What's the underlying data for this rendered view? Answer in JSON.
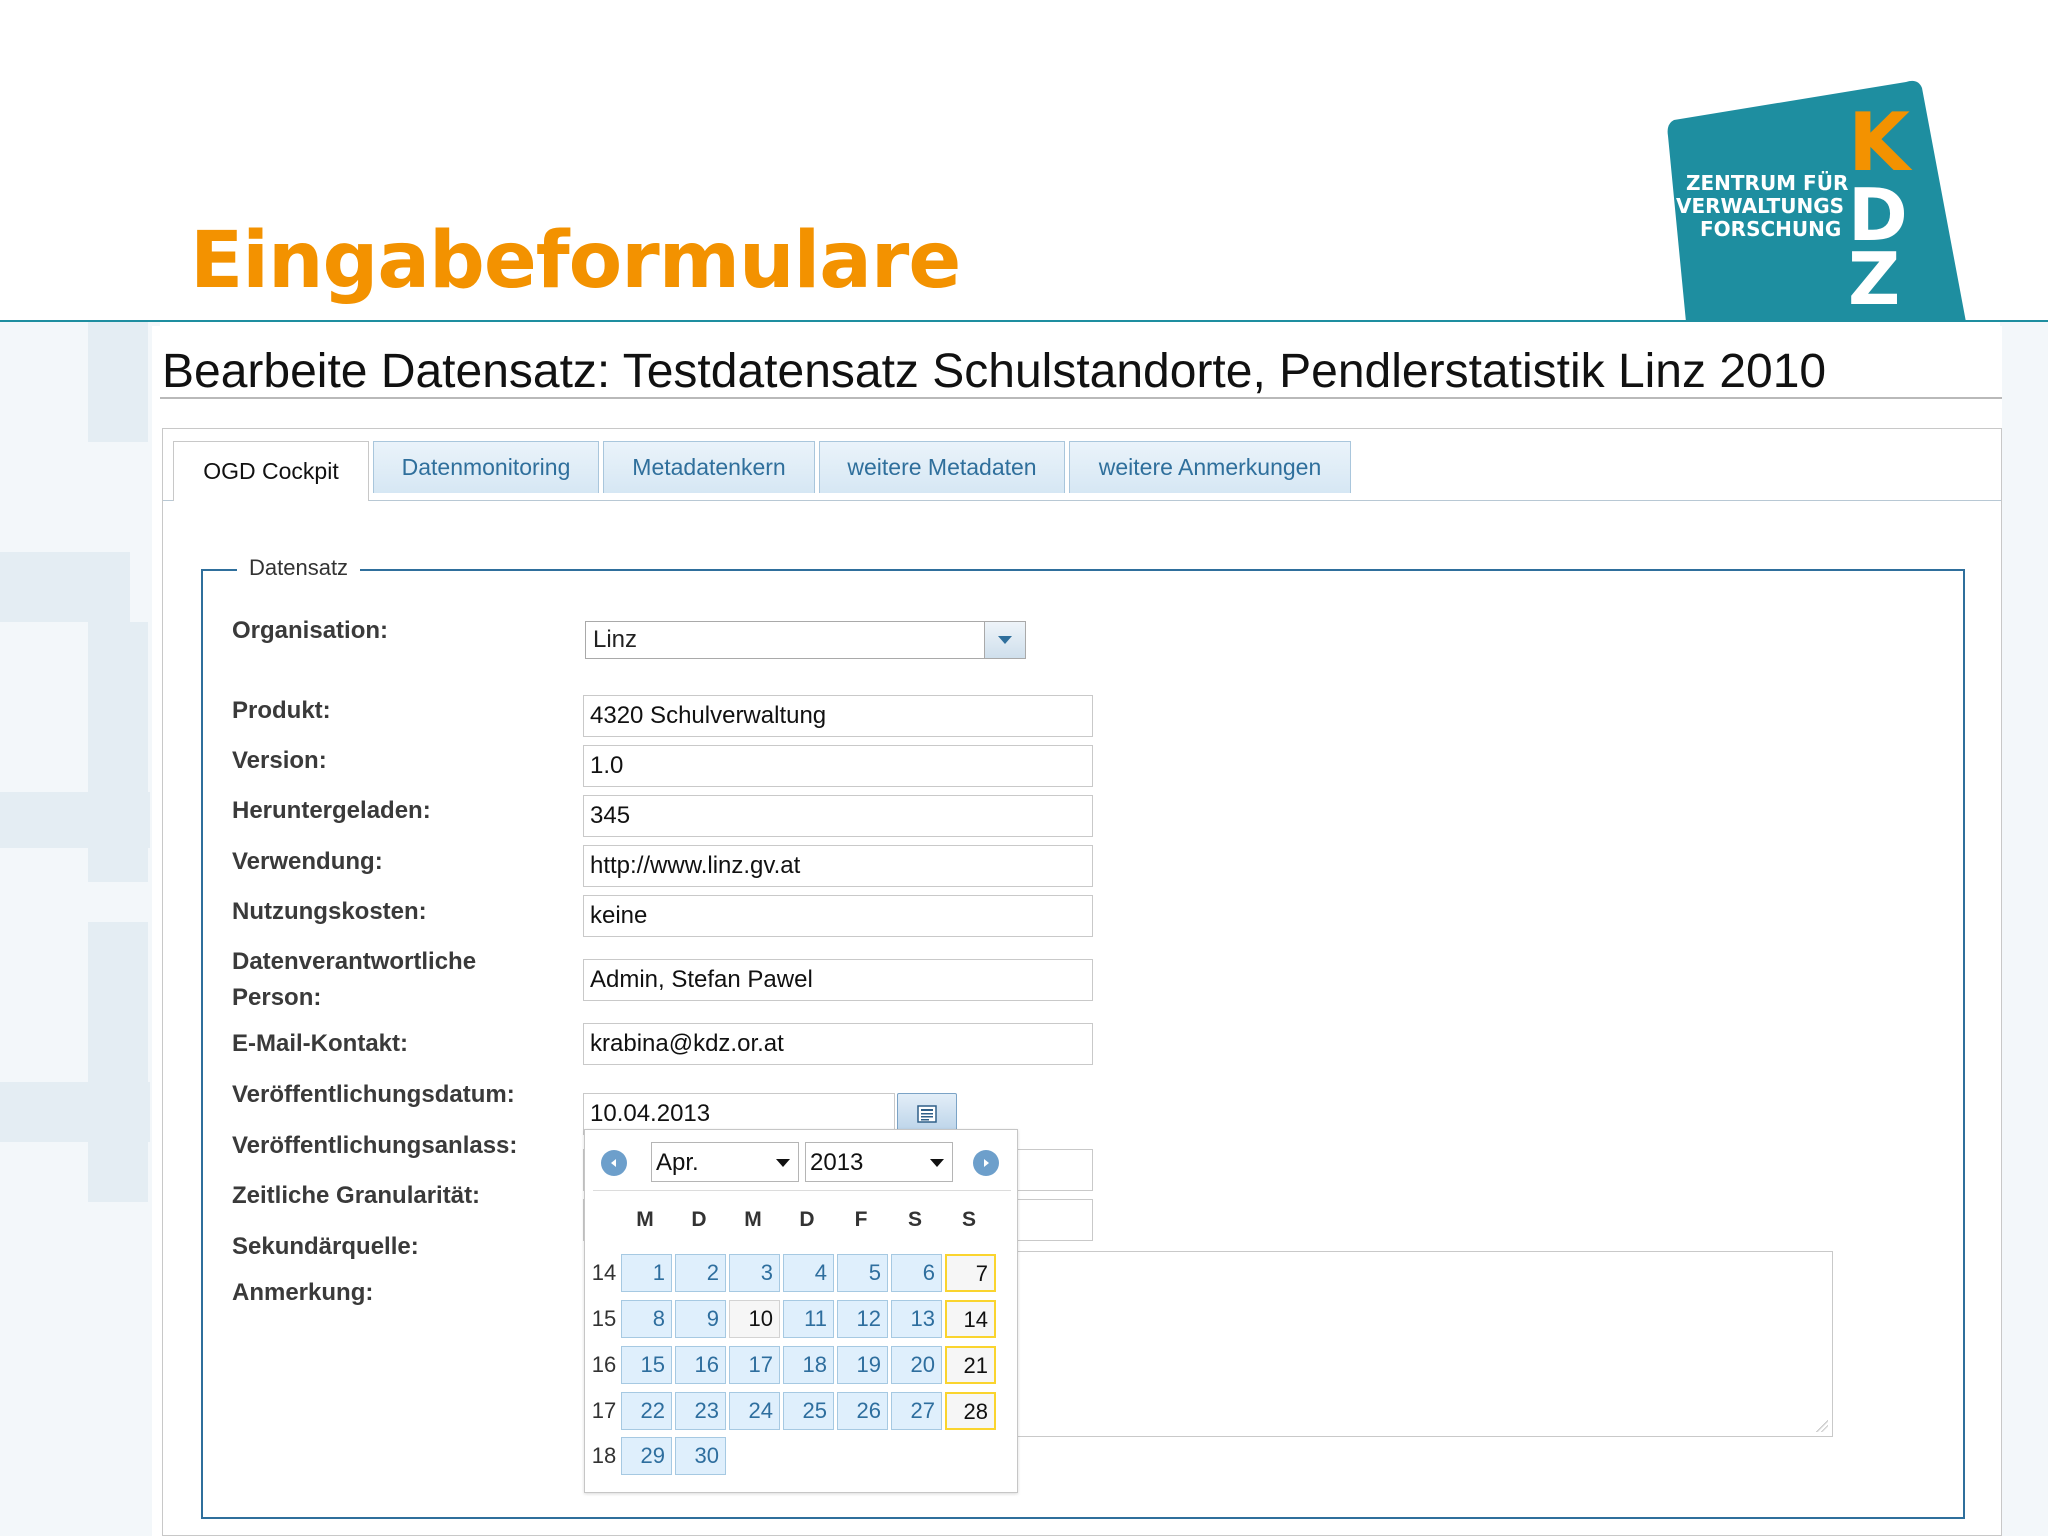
{
  "slide": {
    "title": "Eingabeformulare",
    "logo": {
      "text_lines": [
        "ZENTRUM FÜR",
        "VERWALTUNGS",
        "FORSCHUNG"
      ],
      "letters": [
        "K",
        "D",
        "Z"
      ],
      "brand_color": "#1e8ea0",
      "accent_color": "#f39200"
    }
  },
  "page": {
    "heading": "Bearbeite Datensatz: Testdatensatz Schulstandorte, Pendlerstatistik Linz 2010"
  },
  "tabs": [
    {
      "label": "OGD Cockpit",
      "active": true
    },
    {
      "label": "Datenmonitoring",
      "active": false
    },
    {
      "label": "Metadatenkern",
      "active": false
    },
    {
      "label": "weitere Metadaten",
      "active": false
    },
    {
      "label": "weitere Anmerkungen",
      "active": false
    }
  ],
  "form": {
    "legend": "Datensatz",
    "organisation": {
      "label": "Organisation:",
      "value": "Linz"
    },
    "produkt": {
      "label": "Produkt:",
      "value": "4320 Schulverwaltung"
    },
    "version": {
      "label": "Version:",
      "value": "1.0"
    },
    "heruntergeladen": {
      "label": "Heruntergeladen:",
      "value": "345"
    },
    "verwendung": {
      "label": "Verwendung:",
      "value": "http://www.linz.gv.at"
    },
    "nutzungskosten": {
      "label": "Nutzungskosten:",
      "value": "keine"
    },
    "datenverantwortliche": {
      "label_line1": "Datenverantwortliche",
      "label_line2": "Person:",
      "value": "Admin, Stefan Pawel"
    },
    "email": {
      "label": "E-Mail-Kontakt:",
      "value": "krabina@kdz.or.at"
    },
    "veroeffentlichungsdatum": {
      "label": "Veröffentlichungsdatum:",
      "value": "10.04.2013"
    },
    "veroeffentlichungsanlass": {
      "label": "Veröffentlichungsanlass:",
      "value": ""
    },
    "zeitliche_granularitaet": {
      "label": "Zeitliche Granularität:",
      "value": ""
    },
    "sekundaerquelle": {
      "label": "Sekundärquelle:"
    },
    "anmerkung": {
      "label": "Anmerkung:",
      "value": ""
    }
  },
  "calendar": {
    "month": "Apr.",
    "year": "2013",
    "weekdays": [
      "M",
      "D",
      "M",
      "D",
      "F",
      "S",
      "S"
    ],
    "weeks": [
      {
        "week": "14",
        "days": [
          "1",
          "2",
          "3",
          "4",
          "5",
          "6",
          "7"
        ]
      },
      {
        "week": "15",
        "days": [
          "8",
          "9",
          "10",
          "11",
          "12",
          "13",
          "14"
        ]
      },
      {
        "week": "16",
        "days": [
          "15",
          "16",
          "17",
          "18",
          "19",
          "20",
          "21"
        ]
      },
      {
        "week": "17",
        "days": [
          "22",
          "23",
          "24",
          "25",
          "26",
          "27",
          "28"
        ]
      },
      {
        "week": "18",
        "days": [
          "29",
          "30"
        ]
      }
    ],
    "today": "10",
    "highlight_color": "#fad42e",
    "day_bg_color": "#dfeffc"
  }
}
